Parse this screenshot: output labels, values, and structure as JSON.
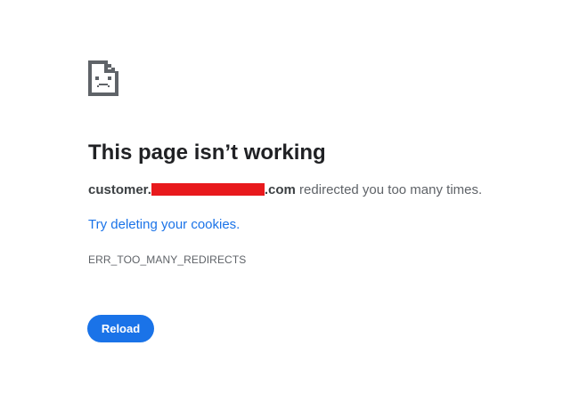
{
  "error_icon": "sad-page-icon",
  "title": "This page isn’t working",
  "description": {
    "domain_prefix": "customer.",
    "domain_suffix": ".com",
    "message": " redirected you too many times."
  },
  "suggestion_link": "Try deleting your cookies.",
  "error_code": "ERR_TOO_MANY_REDIRECTS",
  "reload_label": "Reload",
  "colors": {
    "accent": "#1a73e8",
    "redaction": "#e8191c",
    "title": "#202124",
    "secondary_text": "#5f6368"
  }
}
